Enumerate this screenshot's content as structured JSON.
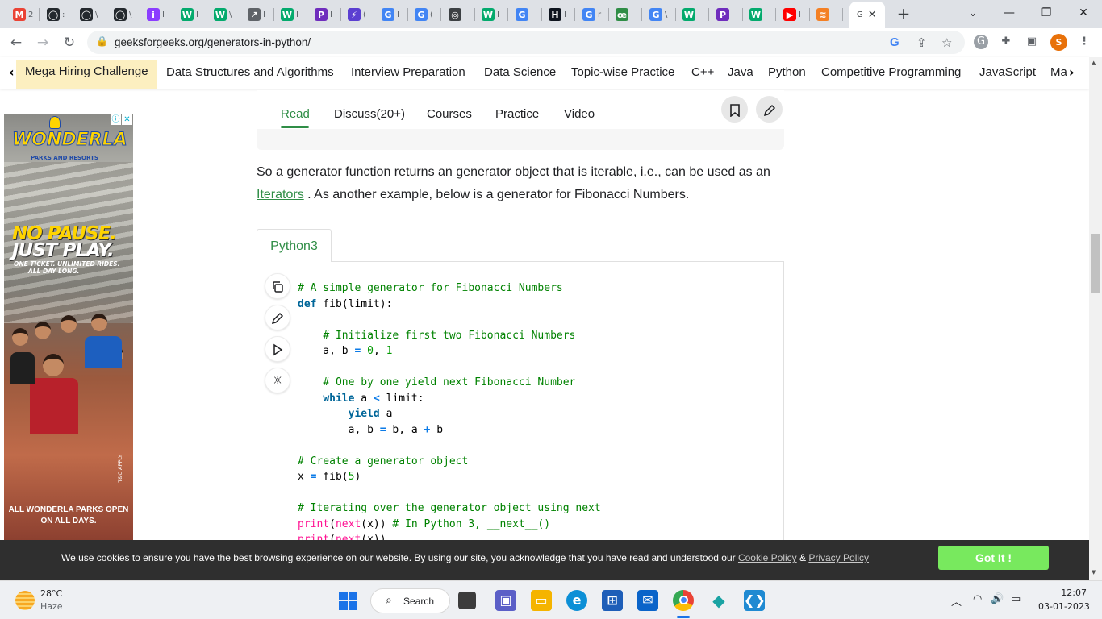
{
  "browser": {
    "tabs": [
      {
        "icon": "gmail-icon",
        "letter": "M",
        "color": "#ea4335",
        "title": "2"
      },
      {
        "icon": "github-icon",
        "letter": "◯",
        "color": "#24292e",
        "title": ":"
      },
      {
        "icon": "github-icon",
        "letter": "◯",
        "color": "#24292e",
        "title": "\\"
      },
      {
        "icon": "github-icon",
        "letter": "◯",
        "color": "#24292e",
        "title": "\\"
      },
      {
        "icon": "tab-purple-icon",
        "letter": "i",
        "color": "#8b3dff",
        "title": "I"
      },
      {
        "icon": "w3schools-icon",
        "letter": "W",
        "color": "#04aa6d",
        "title": "I"
      },
      {
        "icon": "w3schools-icon",
        "letter": "W",
        "color": "#04aa6d",
        "title": "\\"
      },
      {
        "icon": "chart-tab-icon",
        "letter": "↗",
        "color": "#5f6368",
        "title": "I"
      },
      {
        "icon": "w3schools-icon",
        "letter": "W",
        "color": "#04aa6d",
        "title": "I"
      },
      {
        "icon": "tab-violet-icon",
        "letter": "P",
        "color": "#6f2dbd",
        "title": "I"
      },
      {
        "icon": "tab-bolt-icon",
        "letter": "⚡",
        "color": "#5b3fd1",
        "title": "("
      },
      {
        "icon": "google-icon",
        "letter": "G",
        "color": "#4285f4",
        "title": "I"
      },
      {
        "icon": "google-icon",
        "letter": "G",
        "color": "#4285f4",
        "title": "("
      },
      {
        "icon": "chatgpt-icon",
        "letter": "◎",
        "color": "#3c4043",
        "title": "I"
      },
      {
        "icon": "w3schools-icon",
        "letter": "W",
        "color": "#04aa6d",
        "title": "I"
      },
      {
        "icon": "google-icon",
        "letter": "G",
        "color": "#4285f4",
        "title": "I"
      },
      {
        "icon": "hackerrank-icon",
        "letter": "H",
        "color": "#0e141e",
        "title": "I"
      },
      {
        "icon": "google-icon",
        "letter": "G",
        "color": "#4285f4",
        "title": "r"
      },
      {
        "icon": "gfg-icon",
        "letter": "œ",
        "color": "#2f8d46",
        "title": "I"
      },
      {
        "icon": "google-icon",
        "letter": "G",
        "color": "#4285f4",
        "title": "\\"
      },
      {
        "icon": "w3schools-icon",
        "letter": "W",
        "color": "#04aa6d",
        "title": "I"
      },
      {
        "icon": "tab-violet-icon",
        "letter": "P",
        "color": "#6f2dbd",
        "title": "I"
      },
      {
        "icon": "w3schools-icon",
        "letter": "W",
        "color": "#04aa6d",
        "title": "I"
      },
      {
        "icon": "youtube-icon",
        "letter": "▶",
        "color": "#ff0000",
        "title": "I"
      },
      {
        "icon": "stackoverflow-icon",
        "letter": "≋",
        "color": "#f48024",
        "title": ""
      }
    ],
    "active_tab": {
      "title": "G",
      "close": "✕"
    },
    "new_tab": "+",
    "url": "geeksforgeeks.org/generators-in-python/"
  },
  "nav": {
    "items": [
      "Mega Hiring Challenge",
      "Data Structures and Algorithms",
      "Interview Preparation",
      "Data Science",
      "Topic-wise Practice",
      "C++",
      "Java",
      "Python",
      "Competitive Programming",
      "JavaScript",
      "Ma"
    ]
  },
  "ad": {
    "logo": "WONDERLA",
    "logo_sub": "PARKS AND RESORTS",
    "headline1": "NO PAUSE.",
    "headline2": "JUST PLAY.",
    "tagline1": "ONE TICKET. UNLIMITED RIDES.",
    "tagline2": "ALL DAY LONG.",
    "tc": "T&C APPLY",
    "bottom1": "ALL WONDERLA PARKS OPEN",
    "bottom2": "ON ALL DAYS."
  },
  "article": {
    "tabs": [
      "Read",
      "Discuss(20+)",
      "Courses",
      "Practice",
      "Video"
    ],
    "para_before": "So a generator function returns an generator object that is iterable, i.e., can be used as an ",
    "para_link": "Iterators",
    "para_after": " . As another example, below is a generator for Fibonacci Numbers.",
    "code_lang": "Python3"
  },
  "cookie": {
    "text": "We use cookies to ensure you have the best browsing experience on our website. By using our site, you acknowledge that you have read and understood our ",
    "policy": "Cookie Policy",
    "amp": " & ",
    "privacy": "Privacy Policy",
    "button": "Got It !"
  },
  "taskbar": {
    "temp": "28°C",
    "weather": "Haze",
    "search": "Search",
    "time": "12:07",
    "date": "03-01-2023"
  }
}
